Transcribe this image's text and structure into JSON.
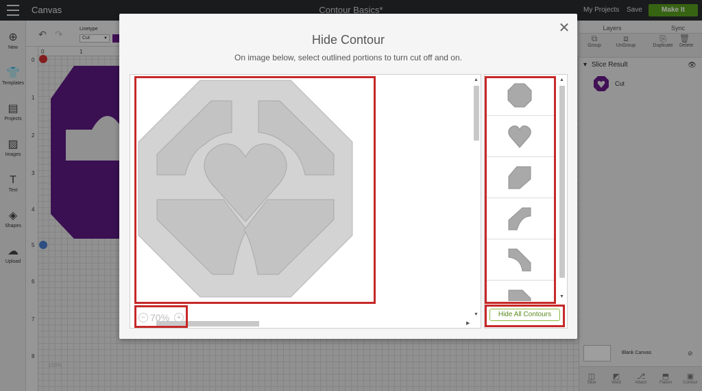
{
  "app": {
    "name": "Canvas",
    "project_title": "Contour Basics*",
    "my_projects": "My Projects",
    "save": "Save",
    "make_it": "Make It"
  },
  "sidebar": {
    "items": [
      {
        "label": "New",
        "icon": "plus-circle-icon"
      },
      {
        "label": "Templates",
        "icon": "shirt-icon"
      },
      {
        "label": "Projects",
        "icon": "projects-icon"
      },
      {
        "label": "Images",
        "icon": "image-icon"
      },
      {
        "label": "Text",
        "icon": "text-icon"
      },
      {
        "label": "Shapes",
        "icon": "shapes-icon"
      },
      {
        "label": "Upload",
        "icon": "upload-cloud-icon"
      }
    ]
  },
  "toolbar": {
    "linetype_label": "Linetype",
    "linetype_value": "Cut",
    "linetype_color": "#6a1b8a"
  },
  "rulers": {
    "horizontal": [
      "0",
      "1"
    ],
    "vertical": [
      "0",
      "1",
      "2",
      "3",
      "4",
      "5",
      "6",
      "7",
      "8"
    ]
  },
  "canvas": {
    "zoom": "100%"
  },
  "right_panel": {
    "tabs": [
      "Layers",
      "Sync"
    ],
    "tools": [
      "Group",
      "UnGroup",
      "Duplicate",
      "Delete"
    ],
    "layer_group": "Slice Result",
    "layer_item": "Cut",
    "blank_canvas": "Blank Canvas",
    "bottom_tools": [
      "Slice",
      "Weld",
      "Attach",
      "Flatten",
      "Contour"
    ]
  },
  "modal": {
    "title": "Hide Contour",
    "subtitle": "On image below, select outlined portions to turn cut off and on.",
    "zoom": "70%",
    "hide_all_label": "Hide All Contours",
    "contours": [
      "octagon",
      "heart",
      "corner-shape",
      "arch-shape",
      "curve-shape",
      "partial-shape"
    ],
    "highlight_color": "#c62828",
    "accent_color": "#6a1b8a"
  }
}
